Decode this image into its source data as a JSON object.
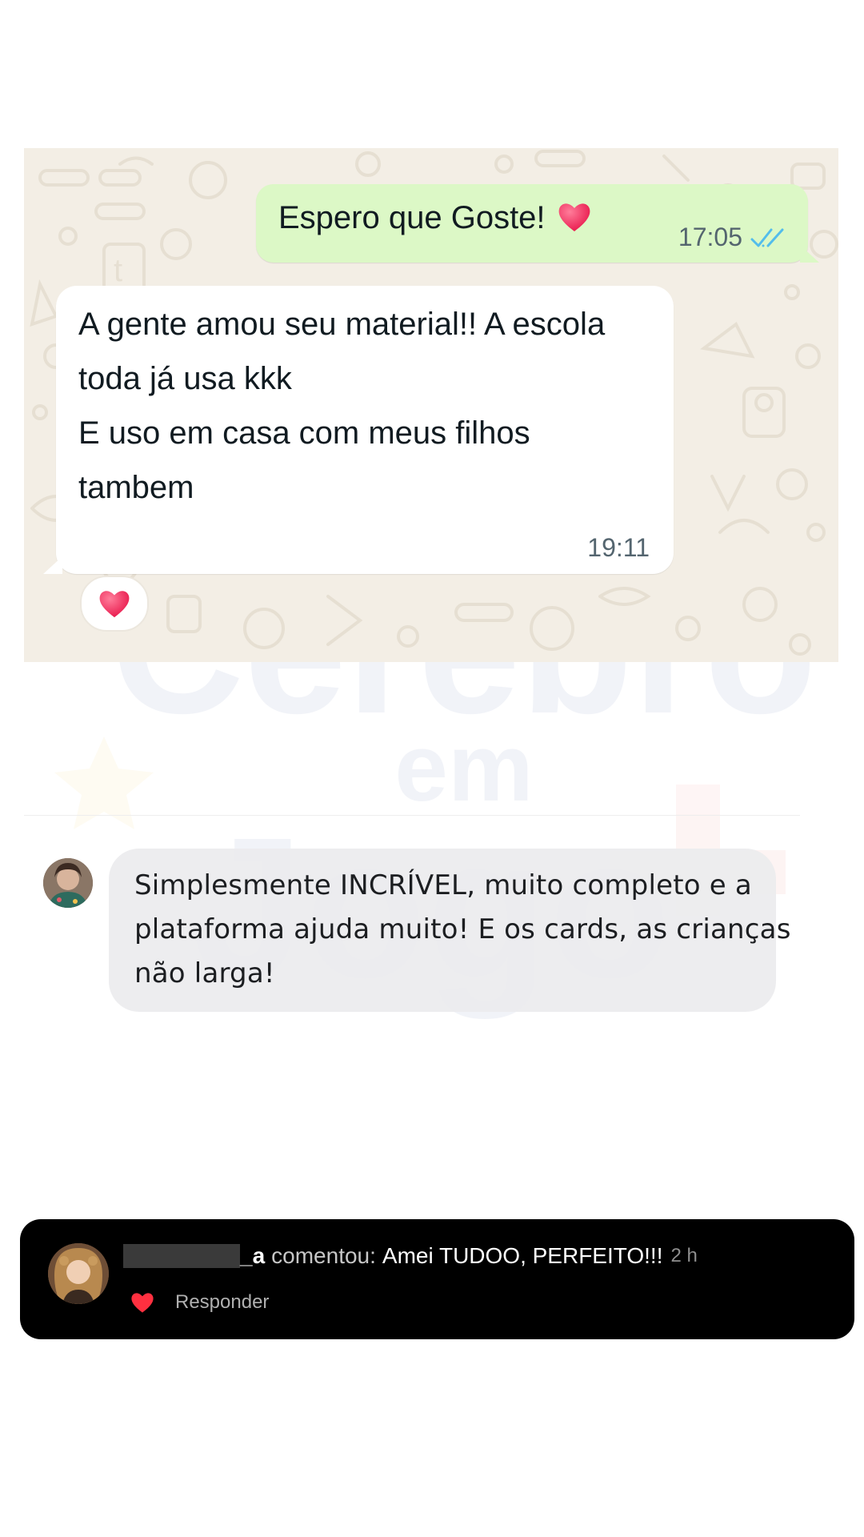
{
  "chat": {
    "outgoing": {
      "text": "Espero que Goste!",
      "emoji": "heart-emoji",
      "time": "17:05",
      "status": "read"
    },
    "incoming": {
      "lines": [
        "A gente amou seu material!! A escola",
        "toda já usa kkk",
        "E uso em casa com meus filhos",
        "tambem"
      ],
      "time": "19:11",
      "reaction": "heart-emoji"
    },
    "colors": {
      "background": "#f3eee5",
      "outgoing_bubble": "#dcf8c6",
      "incoming_bubble": "#ffffff",
      "read_ticks": "#53bdeb"
    }
  },
  "comment": {
    "lines": [
      "Simplesmente INCRÍVEL, muito completo e a",
      "plataforma ajuda muito! E os cards, as crianças",
      "não larga!"
    ]
  },
  "notification": {
    "username_suffix": "_a",
    "action": "comentou:",
    "comment": "Amei TUDOO, PERFEITO!!!",
    "time": "2 h",
    "reply_label": "Responder",
    "like_color": "#ff3040"
  },
  "watermark": {
    "line1": "Cérebro",
    "line2": "em",
    "line3": "Jogo"
  }
}
